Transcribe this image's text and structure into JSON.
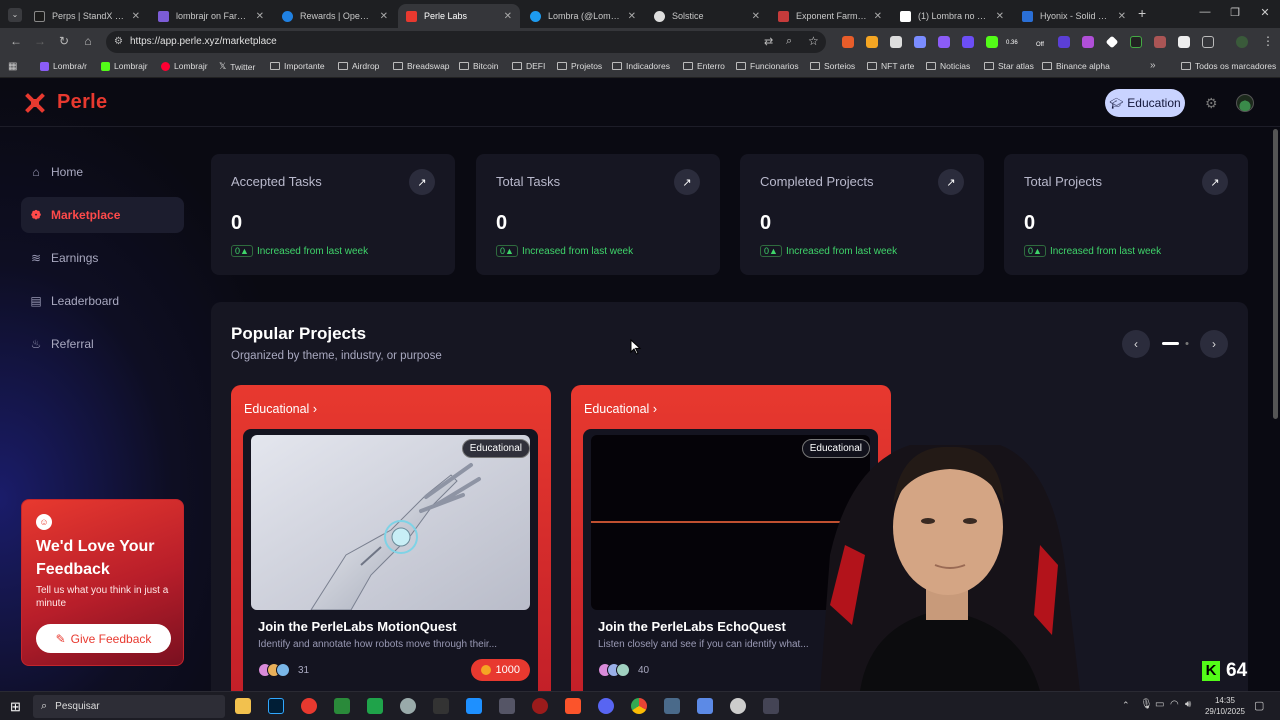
{
  "browser": {
    "tabs": [
      {
        "label": "Perps | StandX Perps",
        "color": "#1a1a1a"
      },
      {
        "label": "lombrajr on Farcaster",
        "color": "#7c5cd6"
      },
      {
        "label": "Rewards | OpenSea",
        "color": "#2081e2"
      },
      {
        "label": "Perle Labs",
        "color": "#e8392f"
      },
      {
        "label": "Lombra (@Lombrajr)",
        "color": "#1d9bf0"
      },
      {
        "label": "Solstice",
        "color": "#dddddd"
      },
      {
        "label": "Exponent Farm — Fe",
        "color": "#c53b3b"
      },
      {
        "label": "(1) Lombra no X: \"He",
        "color": "#ffffff"
      },
      {
        "label": "Hyonix - Solid and af",
        "color": "#2a6fd6"
      }
    ],
    "url": "https://app.perle.xyz/marketplace",
    "bookmarks": [
      {
        "label": "Lombra/r",
        "color": "#8a5cf6"
      },
      {
        "label": "Lombrajr",
        "color": "#53fc18"
      },
      {
        "label": "Lombrajr",
        "color": "#ff0033"
      },
      {
        "label": "Twitter",
        "color": "#ffffff"
      },
      {
        "label": "Importante",
        "folder": true
      },
      {
        "label": "Airdrop",
        "folder": true
      },
      {
        "label": "Breadswap",
        "folder": true
      },
      {
        "label": "Bitcoin",
        "folder": true
      },
      {
        "label": "DEFI",
        "folder": true
      },
      {
        "label": "Projetos",
        "folder": true
      },
      {
        "label": "Indicadores",
        "folder": true
      },
      {
        "label": "Enterro",
        "folder": true
      },
      {
        "label": "Funcionarios",
        "folder": true
      },
      {
        "label": "Sorteios",
        "folder": true
      },
      {
        "label": "NFT arte",
        "folder": true
      },
      {
        "label": "Noticias",
        "folder": true
      },
      {
        "label": "Star atlas",
        "folder": true
      },
      {
        "label": "Binance alpha",
        "folder": true
      }
    ],
    "all_bookmarks": "Todos os marcadores",
    "ext_badge_1": "0.36",
    "ext_badge_2": "Off"
  },
  "header": {
    "logo": "Perle",
    "education_label": "Education"
  },
  "sidebar": {
    "items": [
      {
        "label": "Home",
        "icon": "home-icon"
      },
      {
        "label": "Marketplace",
        "icon": "marketplace-icon",
        "active": true
      },
      {
        "label": "Earnings",
        "icon": "earnings-icon"
      },
      {
        "label": "Leaderboard",
        "icon": "leaderboard-icon"
      },
      {
        "label": "Referral",
        "icon": "referral-icon"
      }
    ],
    "feedback": {
      "title": "We'd Love Your Feedback",
      "subtitle": "Tell us what you think in just a minute",
      "button": "Give Feedback"
    }
  },
  "stats": [
    {
      "title": "Accepted Tasks",
      "value": "0",
      "delta": "0",
      "change": "Increased from last week"
    },
    {
      "title": "Total Tasks",
      "value": "0",
      "delta": "0",
      "change": "Increased from last week"
    },
    {
      "title": "Completed Projects",
      "value": "0",
      "delta": "0",
      "change": "Increased from last week"
    },
    {
      "title": "Total Projects",
      "value": "0",
      "delta": "0",
      "change": "Increased from last week"
    }
  ],
  "popular": {
    "title": "Popular Projects",
    "subtitle": "Organized by theme, industry, or purpose",
    "projects": [
      {
        "category": "Educational",
        "tag": "Educational",
        "name": "Join the PerleLabs MotionQuest",
        "desc": "Identify and annotate how robots move through their...",
        "participants": "31",
        "reward": "1000"
      },
      {
        "category": "Educational",
        "tag": "Educational",
        "name": "Join the PerleLabs EchoQuest",
        "desc": "Listen closely and see if you can identify what...",
        "participants": "40",
        "reward": ""
      }
    ]
  },
  "overlay": {
    "kick_count": "64"
  },
  "taskbar": {
    "search": "Pesquisar",
    "time": "14:35",
    "date": "29/10/2025"
  },
  "colors": {
    "brand": "#e8392f",
    "positive": "#3fd46a",
    "accent": "#c9d3ff"
  }
}
